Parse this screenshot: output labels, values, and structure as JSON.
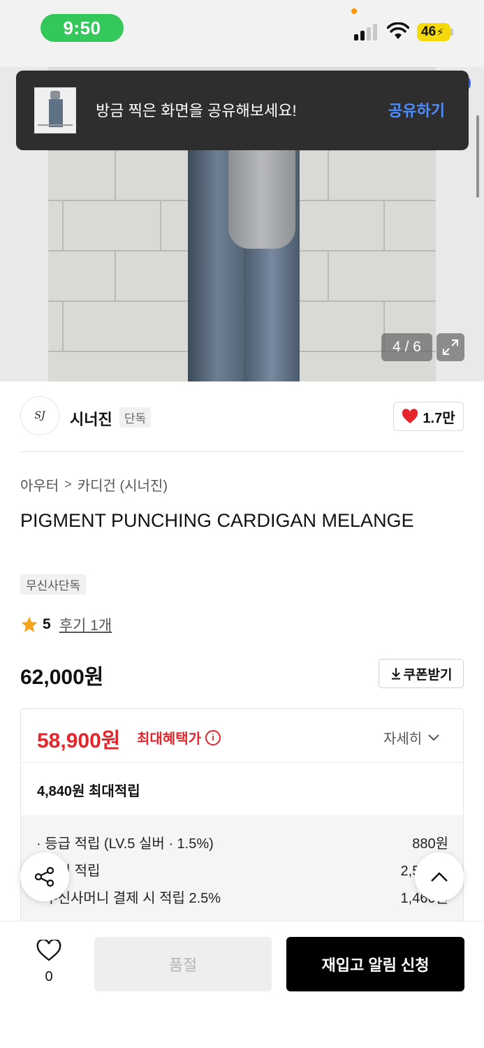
{
  "status_bar": {
    "time": "9:50",
    "battery": "46"
  },
  "gallery": {
    "page_indicator": "4 / 6",
    "expand_icon": "expand-icon"
  },
  "share_toast": {
    "message": "방금 찍은 화면을 공유해보세요!",
    "action": "공유하기"
  },
  "brand": {
    "logo_text": "SJ",
    "name": "시너진",
    "badge": "단독",
    "like_count": "1.7만"
  },
  "product": {
    "breadcrumb": [
      "아우터",
      "카디건 (시너진)"
    ],
    "title": "PIGMENT PUNCHING CARDIGAN MELANGE",
    "exclusive_badge": "무신사단독",
    "rating": "5",
    "reviews": "후기 1개",
    "price": "62,000원",
    "coupon_label": "쿠폰받기"
  },
  "benefit": {
    "sale_price": "58,900원",
    "sale_label": "최대혜택가",
    "detail_label": "자세히",
    "points_total": "4,840원 최대적립",
    "rows": [
      {
        "label": "· 등급 적립 (LV.5 실버 · 1.5%)",
        "amount": "880원"
      },
      {
        "label": "· 후기 적립",
        "amount": "2,500원"
      },
      {
        "label": "· 무신사머니 결제 시 적립 2.5%",
        "amount": "1,460원"
      }
    ]
  },
  "bottom_bar": {
    "wish_count": "0",
    "soldout_label": "품절",
    "restock_label": "재입고 알림 신청"
  },
  "colors": {
    "accent_red": "#e4262b",
    "toast_action_blue": "#4c8dff",
    "status_green": "#34c759",
    "primary_black": "#000000"
  }
}
